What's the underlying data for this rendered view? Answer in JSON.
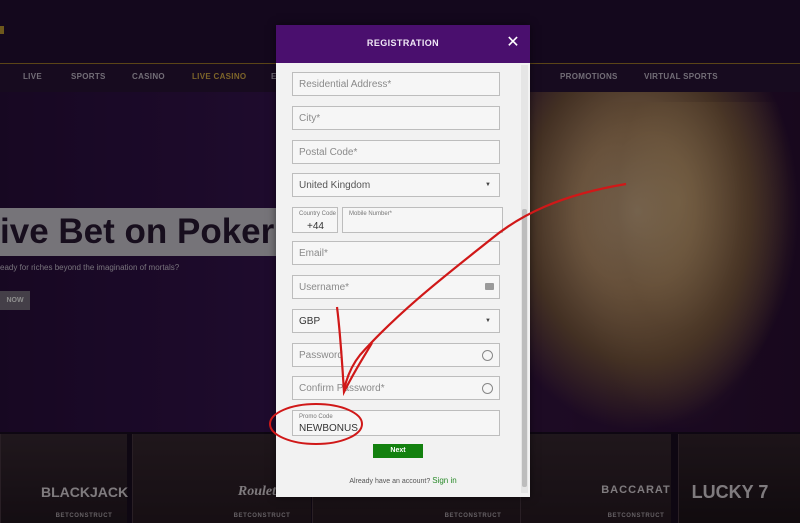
{
  "nav": {
    "items": [
      "LIVE",
      "SPORTS",
      "CASINO",
      "LIVE CASINO",
      "E",
      "PROMOTIONS",
      "VIRTUAL SPORTS"
    ],
    "active_index": 3
  },
  "hero": {
    "title": "ive Bet on Poker",
    "subtitle": "eady for riches beyond the imagination of mortals?",
    "button": "NOW"
  },
  "games": [
    {
      "title": "",
      "brand": ""
    },
    {
      "title": "BLACKJACK",
      "brand": "BETCONSTRUCT"
    },
    {
      "title": "Roulette",
      "brand": "BETCONSTRUCT"
    },
    {
      "title": "",
      "brand": "BETCONSTRUCT"
    },
    {
      "title": "",
      "brand": "BETCONSTRUCT"
    },
    {
      "title": "BACCARAT",
      "brand": "BETCONSTRUCT"
    },
    {
      "title": "LUCKY 7",
      "brand": ""
    }
  ],
  "modal": {
    "title": "REGISTRATION",
    "close_icon": "close-icon",
    "fields": {
      "address": "Residential Address*",
      "city": "City*",
      "postal": "Postal Code*",
      "country": "United Kingdom",
      "country_code_label": "Country Code",
      "country_code_value": "+44",
      "mobile_label": "Mobile Number*",
      "email": "Email*",
      "username": "Username*",
      "currency": "GBP",
      "password": "Password",
      "confirm_password": "Confirm Password*",
      "promo_label": "Promo Code",
      "promo_value": "NEWBONUS"
    },
    "next_label": "Next",
    "signin_prompt": "Already have an account?",
    "signin_link": "Sign in"
  },
  "colors": {
    "modal_header": "#4a0f6e",
    "next_button": "#13810f",
    "annotation": "#d01818",
    "nav_active": "#e2b64b"
  }
}
